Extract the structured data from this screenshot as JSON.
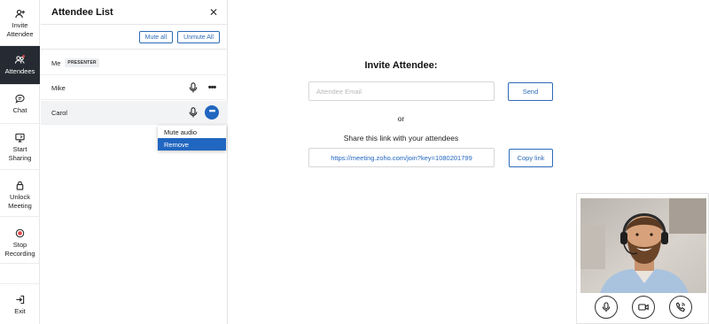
{
  "rail": {
    "items": [
      {
        "id": "invite",
        "label_1": "Invite",
        "label_2": "Attendee",
        "icon": "add-person-icon"
      },
      {
        "id": "attendees",
        "label_1": "Attendees",
        "label_2": "",
        "icon": "people-icon"
      },
      {
        "id": "chat",
        "label_1": "Chat",
        "label_2": "",
        "icon": "chat-bubble-icon"
      },
      {
        "id": "sharing",
        "label_1": "Start",
        "label_2": "Sharing",
        "icon": "monitor-icon"
      },
      {
        "id": "unlock",
        "label_1": "Unlock",
        "label_2": "Meeting",
        "icon": "lock-icon"
      },
      {
        "id": "recording",
        "label_1": "Stop",
        "label_2": "Recording",
        "icon": "record-icon"
      },
      {
        "id": "exit",
        "label_1": "Exit",
        "label_2": "",
        "icon": "exit-icon"
      }
    ],
    "active": "attendees"
  },
  "panel": {
    "title": "Attendee List",
    "close_icon": "close-icon",
    "mute_all_label": "Mute all",
    "unmute_all_label": "Unmute All",
    "attendees": [
      {
        "name": "Me",
        "badge": "PRESENTER"
      },
      {
        "name": "Mike",
        "badge": ""
      },
      {
        "name": "Carol",
        "badge": ""
      }
    ],
    "menu": {
      "items": [
        "Mute audio",
        "Remove"
      ],
      "selected": "Remove"
    }
  },
  "invite": {
    "title": "Invite Attendee:",
    "email_placeholder": "Attendee Email",
    "email_value": "",
    "send_label": "Send",
    "or_text": "or",
    "share_text": "Share this link with your attendees",
    "link": "https://meeting.zoho.com/join?key=1080201799",
    "copy_label": "Copy link"
  },
  "video": {
    "controls": [
      "microphone-icon",
      "camera-icon",
      "phone-icon"
    ]
  },
  "colors": {
    "accent": "#2166c0",
    "rail_active": "#262b33"
  }
}
